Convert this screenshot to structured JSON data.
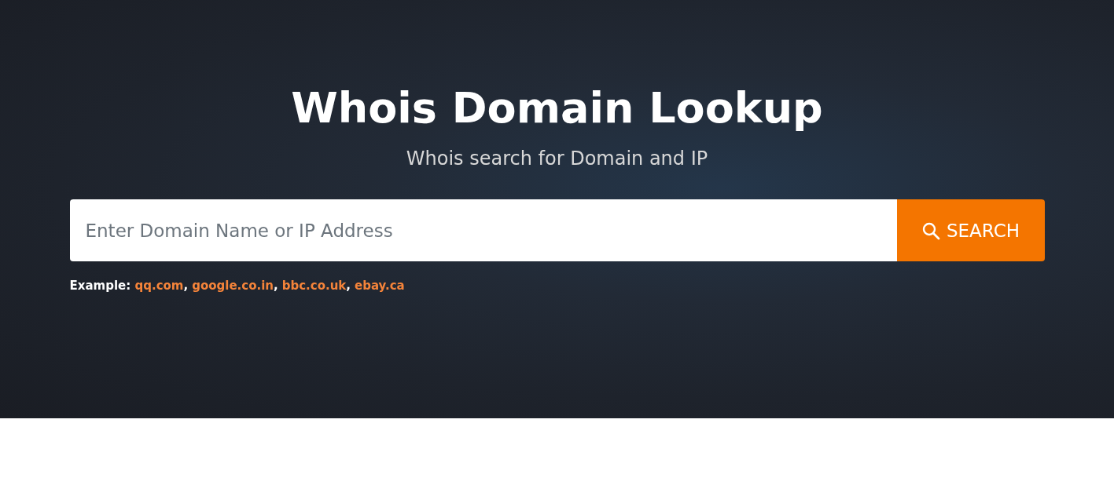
{
  "hero": {
    "title": "Whois Domain Lookup",
    "subtitle": "Whois search for Domain and IP",
    "search": {
      "placeholder": "Enter Domain Name or IP Address",
      "button": "SEARCH"
    },
    "example": {
      "label": "Example:",
      "separator": ",",
      "links": [
        "qq.com",
        "google.co.in",
        "bbc.co.uk",
        "ebay.ca"
      ]
    }
  }
}
